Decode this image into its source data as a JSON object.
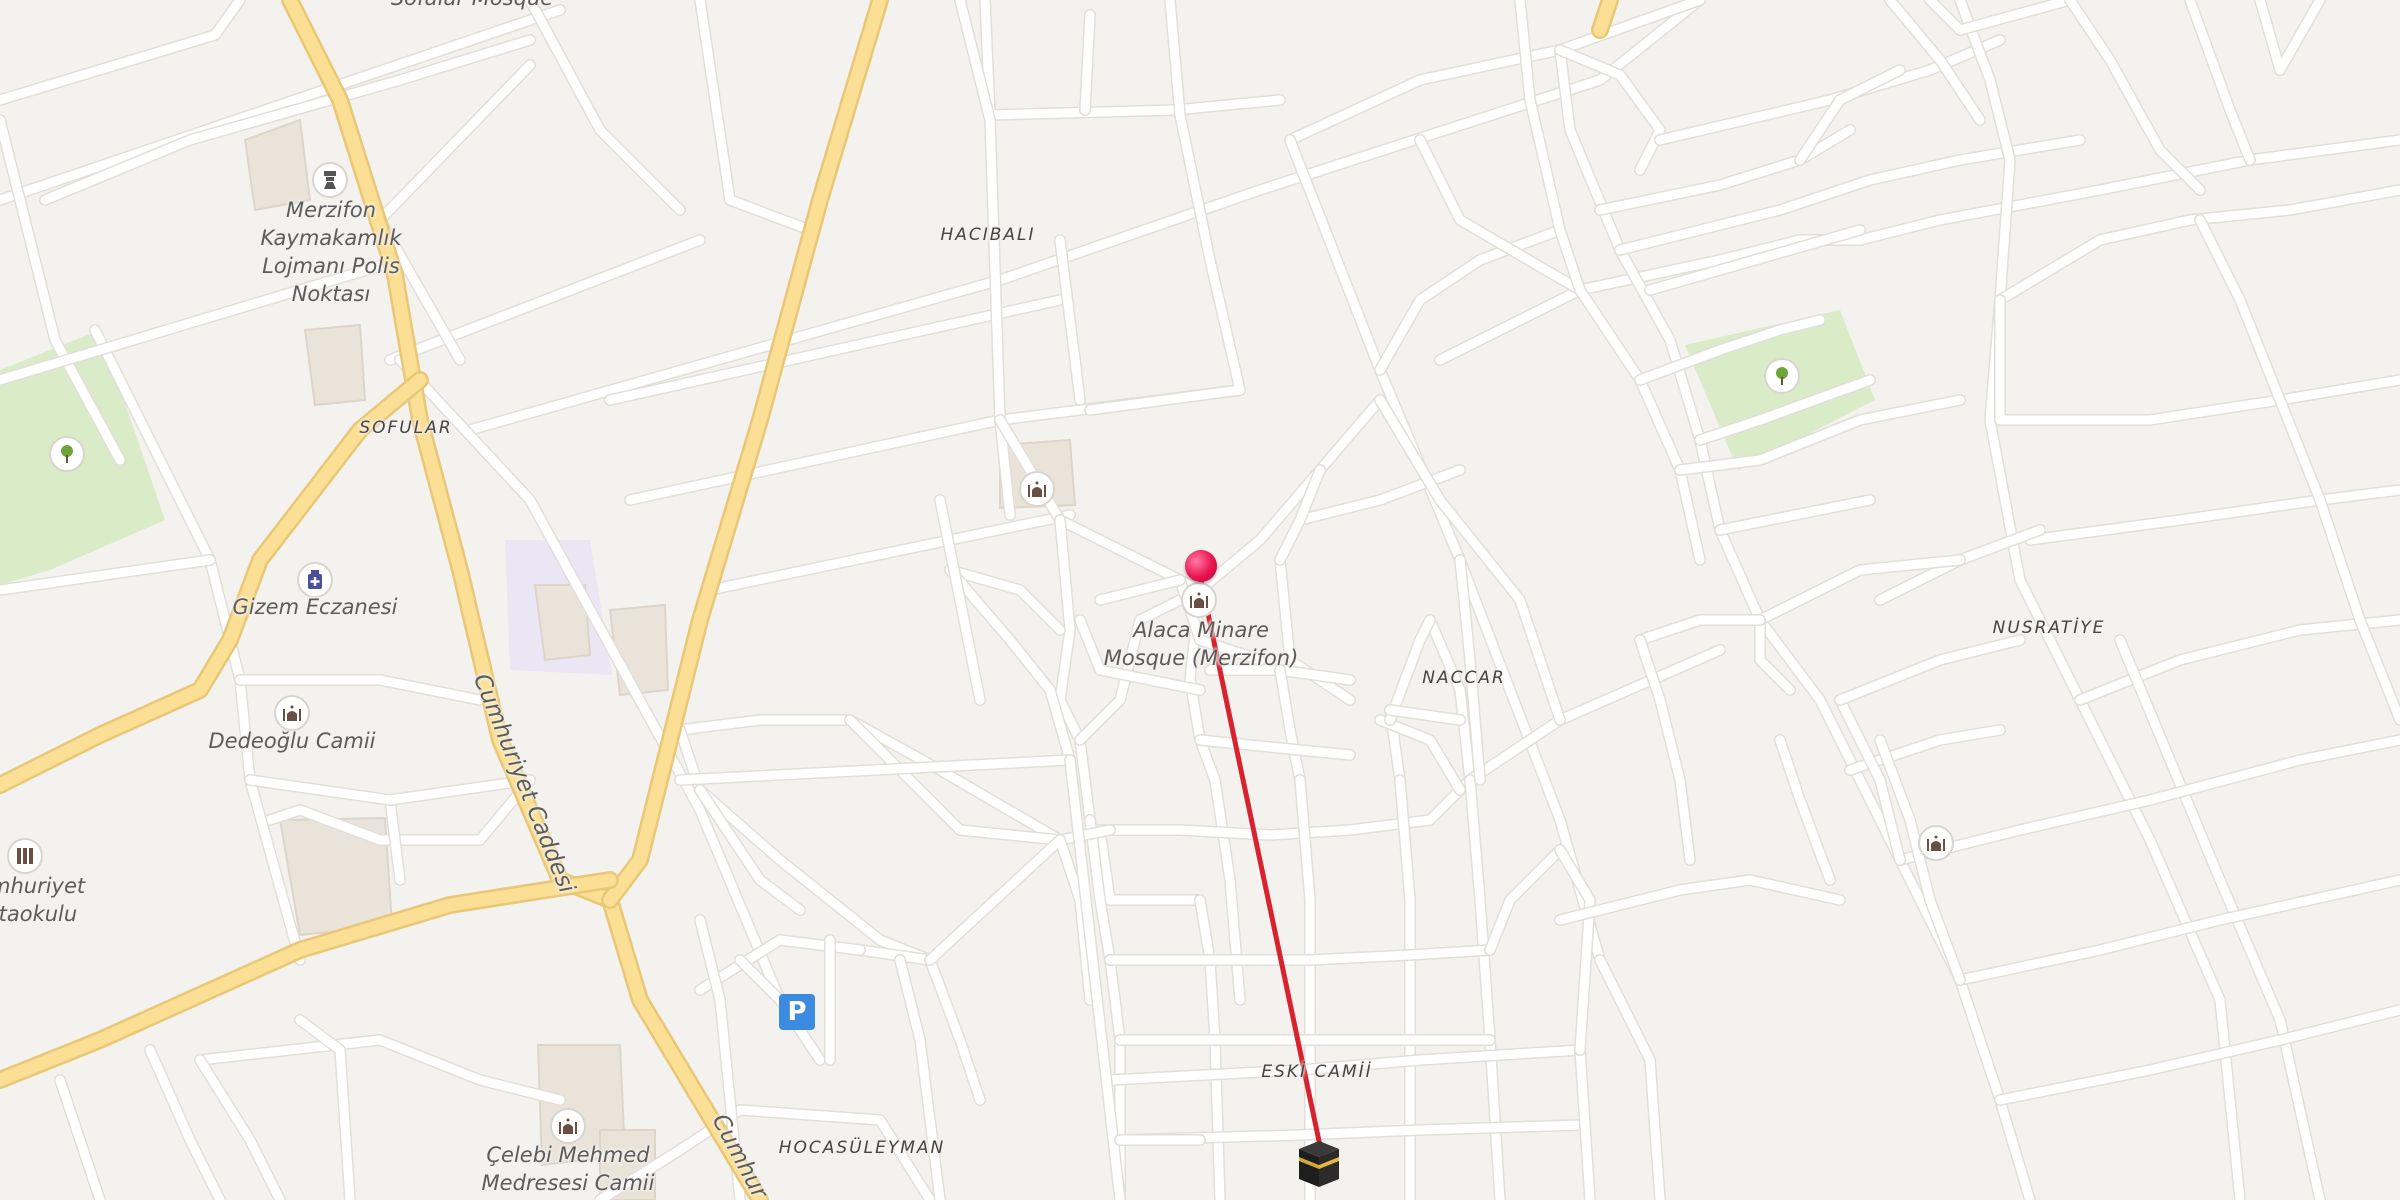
{
  "map": {
    "pois": [
      {
        "id": "merzifon-kaymakamlik",
        "name": "Merzifon\nKaymakamlık\nLojmanı Polis\nNoktası",
        "icon": "police-icon"
      },
      {
        "id": "gizem-eczanesi",
        "name": "Gizem Eczanesi",
        "icon": "pharmacy-icon"
      },
      {
        "id": "dedeoglu-camii",
        "name": "Dedeoğlu Camii",
        "icon": "mosque-icon"
      },
      {
        "id": "cumhuriyet-ortaokulu",
        "name": "mhuriyet\nrtaokulu",
        "icon": "school-icon"
      },
      {
        "id": "alaca-minare",
        "name": "Alaca Minare\nMosque (Merzifon)",
        "icon": "mosque-icon"
      },
      {
        "id": "celebi-mehmed",
        "name": "Çelebi Mehmed\nMedresesi Camii",
        "icon": "mosque-icon"
      },
      {
        "id": "sofular-mosque",
        "name": "Sofular Mosque",
        "icon": "mosque-icon"
      }
    ],
    "areas": {
      "hacibali": "HACIBALI",
      "sofular": "SOFULAR",
      "naccar": "NACCAR",
      "nusratiye": "NUSRATİYE",
      "eski_camii": "ESKİ CAMİİ",
      "hocasuleyman": "HOCASÜLEYMAN"
    },
    "streets": {
      "cumhuriyet_caddesi": "Cumhuriyet Caddesi",
      "cumhuriyet_partial": "Cumhur"
    },
    "parking": {
      "label": "P"
    },
    "qibla": {
      "from": "Alaca Minare Mosque (Merzifon)",
      "to": "Kaaba",
      "line_color": "#d8232f"
    },
    "colors": {
      "background": "#f4f2ef",
      "road": "#ffffff",
      "major_road": "#fbdf95",
      "park": "#d9ebc7",
      "pin": "#e8134f",
      "qibla_line": "#d8232f",
      "parking": "#3d8be0"
    }
  }
}
